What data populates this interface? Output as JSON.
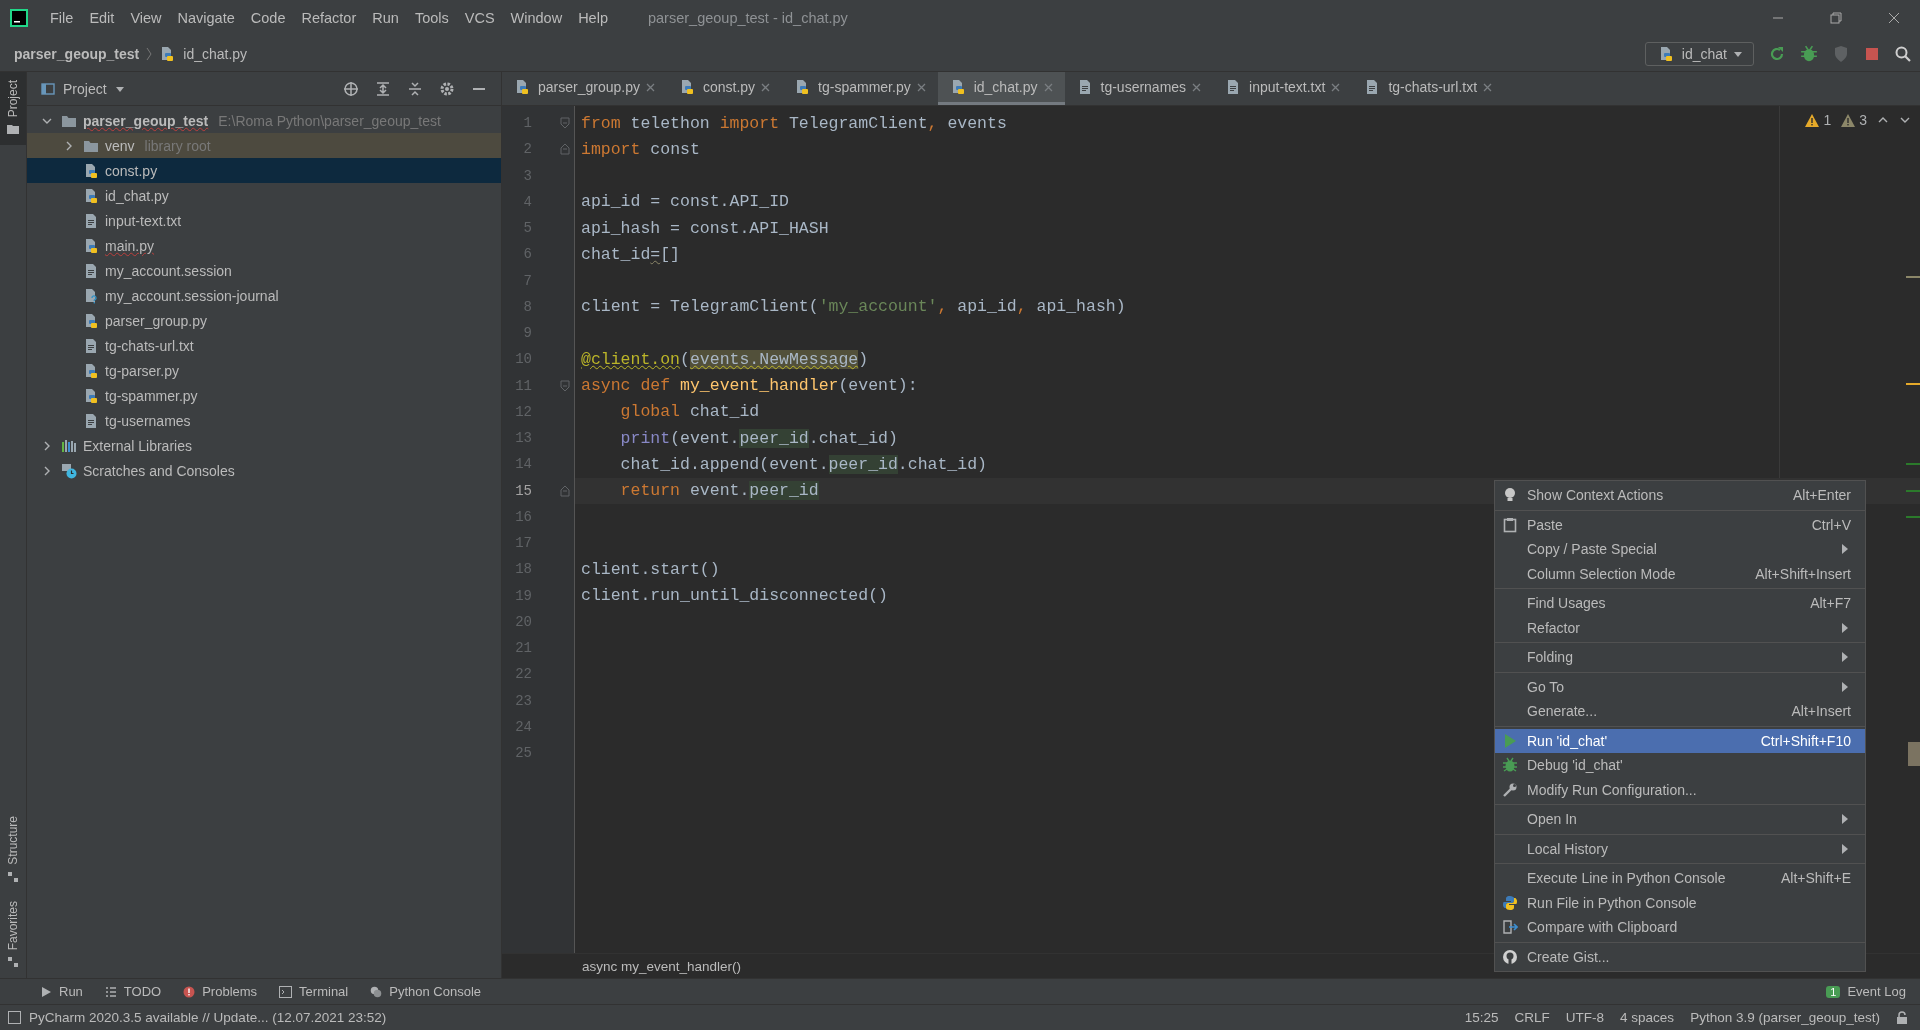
{
  "window": {
    "title": "parser_geoup_test - id_chat.py"
  },
  "menu_bar": [
    "File",
    "Edit",
    "View",
    "Navigate",
    "Code",
    "Refactor",
    "Run",
    "Tools",
    "VCS",
    "Window",
    "Help"
  ],
  "breadcrumb": [
    {
      "label": "parser_geoup_test",
      "kind": "project"
    },
    {
      "label": "id_chat.py",
      "kind": "python"
    }
  ],
  "run_config": {
    "label": "id_chat"
  },
  "tool_strip": {
    "top": [
      {
        "label": "Project",
        "selected": true
      }
    ],
    "bottom": [
      {
        "label": "Structure",
        "selected": false
      },
      {
        "label": "Favorites",
        "selected": false
      }
    ]
  },
  "project": {
    "title": "Project",
    "tree": [
      {
        "label": "parser_geoup_test",
        "kind": "project-folder",
        "hint": "E:\\Roma Python\\parser_geoup_test",
        "expanded": true,
        "selected": false,
        "error": true,
        "children": [
          {
            "label": "venv",
            "kind": "library-root",
            "hint": "library root",
            "expanded": false,
            "selected": false,
            "error": false
          },
          {
            "label": "const.py",
            "kind": "python",
            "selected": true,
            "error": false
          },
          {
            "label": "id_chat.py",
            "kind": "python",
            "selected": false,
            "error": false
          },
          {
            "label": "input-text.txt",
            "kind": "text",
            "selected": false,
            "error": false
          },
          {
            "label": "main.py",
            "kind": "python",
            "selected": false,
            "error": true
          },
          {
            "label": "my_account.session",
            "kind": "text",
            "selected": false,
            "error": false
          },
          {
            "label": "my_account.session-journal",
            "kind": "unknown",
            "selected": false,
            "error": false
          },
          {
            "label": "parser_group.py",
            "kind": "python",
            "selected": false,
            "error": false
          },
          {
            "label": "tg-chats-url.txt",
            "kind": "text",
            "selected": false,
            "error": false
          },
          {
            "label": "tg-parser.py",
            "kind": "python",
            "selected": false,
            "error": false
          },
          {
            "label": "tg-spammer.py",
            "kind": "python",
            "selected": false,
            "error": false
          },
          {
            "label": "tg-usernames",
            "kind": "text",
            "selected": false,
            "error": false
          }
        ]
      },
      {
        "label": "External Libraries",
        "kind": "libraries",
        "expanded": false,
        "selected": false,
        "error": false
      },
      {
        "label": "Scratches and Consoles",
        "kind": "scratches",
        "expanded": false,
        "selected": false,
        "error": false
      }
    ]
  },
  "tabs": [
    {
      "label": "parser_group.py",
      "kind": "python",
      "selected": false
    },
    {
      "label": "const.py",
      "kind": "python",
      "selected": false
    },
    {
      "label": "tg-spammer.py",
      "kind": "python",
      "selected": false
    },
    {
      "label": "id_chat.py",
      "kind": "python",
      "selected": true
    },
    {
      "label": "tg-usernames",
      "kind": "text",
      "selected": false
    },
    {
      "label": "input-text.txt",
      "kind": "text",
      "selected": false
    },
    {
      "label": "tg-chats-url.txt",
      "kind": "text",
      "selected": false
    }
  ],
  "editor": {
    "inspections": [
      {
        "count": "1",
        "kind": "warning"
      },
      {
        "count": "3",
        "kind": "weak"
      }
    ],
    "lines": [
      {
        "number": "1",
        "current": false,
        "fold_start": true,
        "fold_end": false,
        "tokens": [
          {
            "text": "from",
            "kind": "keyword"
          },
          {
            "text": " telethon",
            "kind": "plain"
          },
          {
            "text": " import",
            "kind": "keyword"
          },
          {
            "text": " TelegramClient",
            "kind": "plain"
          },
          {
            "text": ",",
            "kind": "keyword"
          },
          {
            "text": " events",
            "kind": "plain"
          }
        ]
      },
      {
        "number": "2",
        "current": false,
        "fold_start": false,
        "fold_end": true,
        "tokens": [
          {
            "text": "import",
            "kind": "keyword"
          },
          {
            "text": " const",
            "kind": "plain"
          }
        ]
      },
      {
        "number": "3",
        "current": false,
        "fold_start": false,
        "fold_end": false
      },
      {
        "number": "4",
        "current": false,
        "fold_start": false,
        "fold_end": false,
        "tokens": [
          {
            "text": "api_id = const.API_ID",
            "kind": "plain"
          }
        ]
      },
      {
        "number": "5",
        "current": false,
        "fold_start": false,
        "fold_end": false,
        "tokens": [
          {
            "text": "api_hash = const.API_HASH",
            "kind": "plain"
          }
        ]
      },
      {
        "number": "6",
        "current": false,
        "fold_start": false,
        "fold_end": false,
        "tokens": [
          {
            "text": "chat_id",
            "kind": "plain"
          },
          {
            "text": "=",
            "kind": "weak-warning"
          },
          {
            "text": "[]",
            "kind": "plain"
          }
        ]
      },
      {
        "number": "7",
        "current": false,
        "fold_start": false,
        "fold_end": false
      },
      {
        "number": "8",
        "current": false,
        "fold_start": false,
        "fold_end": false,
        "tokens": [
          {
            "text": "client = TelegramClient(",
            "kind": "plain"
          },
          {
            "text": "'my_account'",
            "kind": "string"
          },
          {
            "text": ",",
            "kind": "keyword"
          },
          {
            "text": " api_id",
            "kind": "plain"
          },
          {
            "text": ",",
            "kind": "keyword"
          },
          {
            "text": " api_hash)",
            "kind": "plain"
          }
        ]
      },
      {
        "number": "9",
        "current": false,
        "fold_start": false,
        "fold_end": false
      },
      {
        "number": "10",
        "current": false,
        "fold_start": false,
        "fold_end": false,
        "tokens": [
          {
            "text": "@client.on",
            "kind": "decorator"
          },
          {
            "text": "(",
            "kind": "plain"
          },
          {
            "text": "events.NewMessage",
            "kind": "warning"
          },
          {
            "text": ")",
            "kind": "plain"
          }
        ]
      },
      {
        "number": "11",
        "current": false,
        "fold_start": true,
        "fold_end": false,
        "tokens": [
          {
            "text": "async",
            "kind": "keyword"
          },
          {
            "text": " def",
            "kind": "keyword"
          },
          {
            "text": " my_event_handler",
            "kind": "function"
          },
          {
            "text": "(event):",
            "kind": "plain"
          }
        ]
      },
      {
        "number": "12",
        "current": false,
        "fold_start": false,
        "fold_end": false,
        "tokens": [
          {
            "text": "    global",
            "kind": "keyword"
          },
          {
            "text": " chat_id",
            "kind": "plain"
          }
        ]
      },
      {
        "number": "13",
        "current": false,
        "fold_start": false,
        "fold_end": false,
        "tokens": [
          {
            "text": "    print",
            "kind": "builtin"
          },
          {
            "text": "(event.",
            "kind": "plain"
          },
          {
            "text": "peer_id",
            "kind": "usage"
          },
          {
            "text": ".chat_id)",
            "kind": "plain"
          }
        ]
      },
      {
        "number": "14",
        "current": false,
        "fold_start": false,
        "fold_end": false,
        "tokens": [
          {
            "text": "    chat_id.append(event.",
            "kind": "plain"
          },
          {
            "text": "peer_id",
            "kind": "usage"
          },
          {
            "text": ".chat_id)",
            "kind": "plain"
          }
        ]
      },
      {
        "number": "15",
        "current": true,
        "fold_start": false,
        "fold_end": true,
        "tokens": [
          {
            "text": "    return",
            "kind": "keyword"
          },
          {
            "text": " event.",
            "kind": "plain"
          },
          {
            "text": "peer_id",
            "kind": "usage"
          }
        ]
      },
      {
        "number": "16",
        "current": false,
        "fold_start": false,
        "fold_end": false
      },
      {
        "number": "17",
        "current": false,
        "fold_start": false,
        "fold_end": false
      },
      {
        "number": "18",
        "current": false,
        "fold_start": false,
        "fold_end": false,
        "tokens": [
          {
            "text": "client.start()",
            "kind": "plain"
          }
        ]
      },
      {
        "number": "19",
        "current": false,
        "fold_start": false,
        "fold_end": false,
        "tokens": [
          {
            "text": "client.run_until_disconnected()",
            "kind": "plain"
          }
        ]
      },
      {
        "number": "20",
        "current": false,
        "fold_start": false,
        "fold_end": false
      },
      {
        "number": "21",
        "current": false,
        "fold_start": false,
        "fold_end": false
      },
      {
        "number": "22",
        "current": false,
        "fold_start": false,
        "fold_end": false
      },
      {
        "number": "23",
        "current": false,
        "fold_start": false,
        "fold_end": false
      },
      {
        "number": "24",
        "current": false,
        "fold_start": false,
        "fold_end": false
      },
      {
        "number": "25",
        "current": false,
        "fold_start": false,
        "fold_end": false
      }
    ],
    "breadcrumb": "async my_event_handler()"
  },
  "context_menu": {
    "groups": [
      [
        {
          "label": "Show Context Actions",
          "shortcut": "Alt+Enter",
          "submenu": false,
          "selected": false
        }
      ],
      [
        {
          "label": "Paste",
          "shortcut": "Ctrl+V",
          "submenu": false,
          "selected": false
        },
        {
          "label": "Copy / Paste Special",
          "submenu": true,
          "selected": false
        },
        {
          "label": "Column Selection Mode",
          "shortcut": "Alt+Shift+Insert",
          "submenu": false,
          "selected": false
        }
      ],
      [
        {
          "label": "Find Usages",
          "shortcut": "Alt+F7",
          "submenu": false,
          "selected": false
        },
        {
          "label": "Refactor",
          "submenu": true,
          "selected": false
        }
      ],
      [
        {
          "label": "Folding",
          "submenu": true,
          "selected": false
        }
      ],
      [
        {
          "label": "Go To",
          "submenu": true,
          "selected": false
        },
        {
          "label": "Generate...",
          "shortcut": "Alt+Insert",
          "submenu": false,
          "selected": false
        }
      ],
      [
        {
          "label": "Run 'id_chat'",
          "shortcut": "Ctrl+Shift+F10",
          "submenu": false,
          "selected": true
        },
        {
          "label": "Debug 'id_chat'",
          "submenu": false,
          "selected": false
        },
        {
          "label": "Modify Run Configuration...",
          "submenu": false,
          "selected": false
        }
      ],
      [
        {
          "label": "Open In",
          "submenu": true,
          "selected": false
        }
      ],
      [
        {
          "label": "Local History",
          "submenu": true,
          "selected": false
        }
      ],
      [
        {
          "label": "Execute Line in Python Console",
          "shortcut": "Alt+Shift+E",
          "submenu": false,
          "selected": false
        },
        {
          "label": "Run File in Python Console",
          "submenu": false,
          "selected": false
        },
        {
          "label": "Compare with Clipboard",
          "submenu": false,
          "selected": false
        }
      ],
      [
        {
          "label": "Create Gist...",
          "submenu": false,
          "selected": false
        }
      ]
    ]
  },
  "tool_windows": [
    {
      "label": "Run",
      "kind": "run"
    },
    {
      "label": "TODO",
      "kind": "todo"
    },
    {
      "label": "Problems",
      "kind": "problems"
    },
    {
      "label": "Terminal",
      "kind": "terminal"
    },
    {
      "label": "Python Console",
      "kind": "python"
    }
  ],
  "event_log": {
    "label": "Event Log",
    "badge": "1"
  },
  "status_bar": {
    "message": "PyCharm 2020.3.5 available // Update... (12.07.2021 23:52)",
    "items": [
      "15:25",
      "CRLF",
      "UTF-8",
      "4 spaces",
      "Python 3.9 (parser_geoup_test)"
    ]
  }
}
